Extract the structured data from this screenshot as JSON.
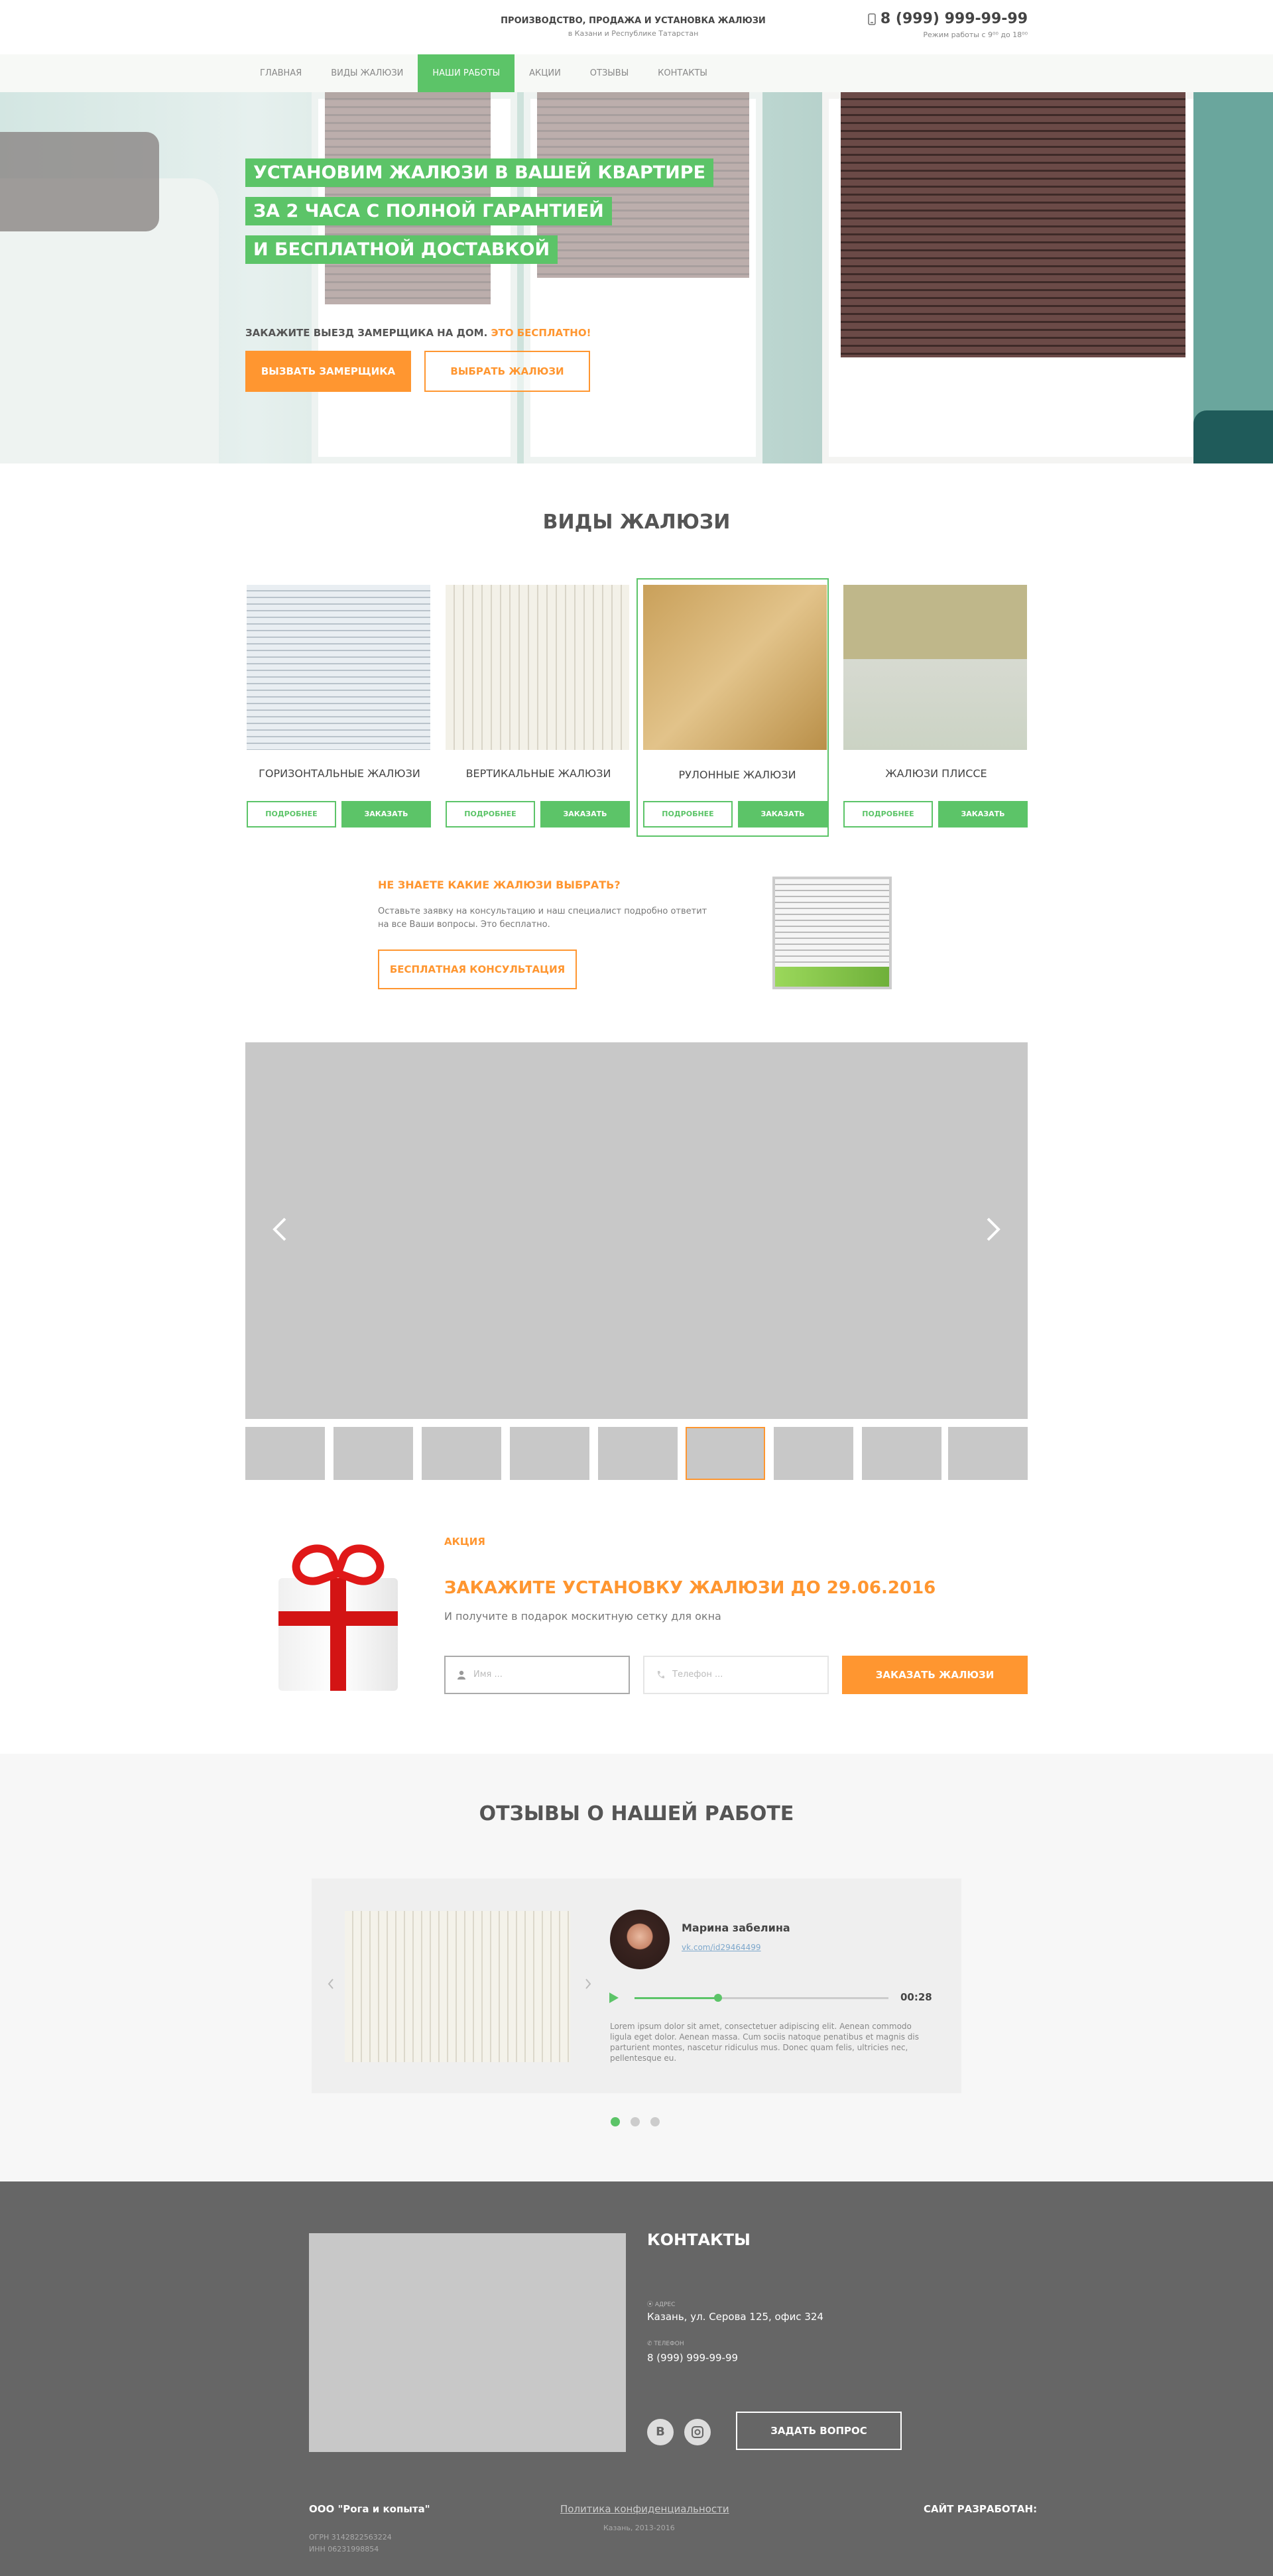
{
  "header": {
    "tagline": "ПРОИЗВОДСТВО, ПРОДАЖА И УСТАНОВКА ЖАЛЮЗИ",
    "region": "в Казани и Республике Татарстан",
    "phone": "8 (999) 999-99-99",
    "hours": "Режим работы с 9⁰⁰ до 18⁰⁰",
    "phone_icon": "phone-icon"
  },
  "nav": {
    "items": [
      "ГЛАВНАЯ",
      "ВИДЫ ЖАЛЮЗИ",
      "НАШИ РАБОТЫ",
      "АКЦИИ",
      "ОТЗЫВЫ",
      "КОНТАКТЫ"
    ],
    "active": "НАШИ РАБОТЫ"
  },
  "hero": {
    "lines": [
      "УСТАНОВИМ ЖАЛЮЗИ В ВАШЕЙ КВАРТИРЕ",
      "ЗА 2 ЧАСА С ПОЛНОЙ ГАРАНТИЕЙ",
      "И БЕСПЛАТНОЙ ДОСТАВКОЙ"
    ],
    "cta_text": "ЗАКАЖИТЕ ВЫЕЗД ЗАМЕРЩИКА НА ДОМ.",
    "cta_free": "ЭТО БЕСПЛАТНО!",
    "btn_call": "ВЫЗВАТЬ ЗАМЕРЩИКА",
    "btn_choose": "ВЫБРАТЬ ЖАЛЮЗИ"
  },
  "types": {
    "title": "ВИДЫ ЖАЛЮЗИ",
    "cards": [
      {
        "name": "ГОРИЗОНТАЛЬНЫЕ ЖАЛЮЗИ",
        "more": "ПОДРОБНЕЕ",
        "order": "ЗАКАЗАТЬ"
      },
      {
        "name": "ВЕРТИКАЛЬНЫЕ ЖАЛЮЗИ",
        "more": "ПОДРОБНЕЕ",
        "order": "ЗАКАЗАТЬ"
      },
      {
        "name": "РУЛОННЫЕ ЖАЛЮЗИ",
        "more": "ПОДРОБНЕЕ",
        "order": "ЗАКАЗАТЬ"
      },
      {
        "name": "ЖАЛЮЗИ ПЛИССЕ",
        "more": "ПОДРОБНЕЕ",
        "order": "ЗАКАЗАТЬ"
      }
    ]
  },
  "consult": {
    "title": "НЕ ЗНАЕТЕ КАКИЕ ЖАЛЮЗИ ВЫБРАТЬ?",
    "text": "Оставьте заявку на консультацию и наш специалист подробно ответит на все Ваши вопросы. Это бесплатно.",
    "button": "БЕСПЛАТНАЯ КОНСУЛЬТАЦИЯ"
  },
  "gallery": {
    "prev_icon": "chevron-left-icon",
    "next_icon": "chevron-right-icon",
    "thumb_count": 9
  },
  "promo": {
    "label": "АКЦИЯ",
    "title": "ЗАКАЖИТЕ УСТАНОВКУ ЖАЛЮЗИ ДО 29.06.2016",
    "text": "И получите в подарок москитную сетку для окна",
    "name_placeholder": "Имя ...",
    "phone_placeholder": "Телефон ...",
    "button": "ЗАКАЗАТЬ ЖАЛЮЗИ"
  },
  "reviews": {
    "title": "ОТЗЫВЫ О НАШЕЙ РАБОТЕ",
    "name": "Марина забелина",
    "link": "vk.com/id29464499",
    "time": "00:28",
    "text": "Lorem ipsum dolor sit amet, consectetuer adipiscing elit. Aenean commodo ligula eget dolor. Aenean massa. Cum sociis natoque penatibus et magnis dis parturient montes, nascetur ridiculus mus. Donec quam felis, ultricies nec, pellentesque eu.",
    "progress": 0.33
  },
  "footer": {
    "title": "КОНТАКТЫ",
    "address_label": "АДРЕС",
    "address": "Казань, ул. Серова 125, офис 324",
    "phone_label": "ТЕЛЕФОН",
    "phone": "8 (999) 999-99-99",
    "vk": "В",
    "ask_button": "ЗАДАТЬ ВОПРОС",
    "company": "ООО \"Рога и копыта\"",
    "ogrn": "ОГРН 3142822563224",
    "inn": "ИНН 06231998854",
    "policy": "Политика конфиденциальности",
    "city_years": "Казань, 2013-2016",
    "developer": "САЙТ РАЗРАБОТАН:"
  }
}
